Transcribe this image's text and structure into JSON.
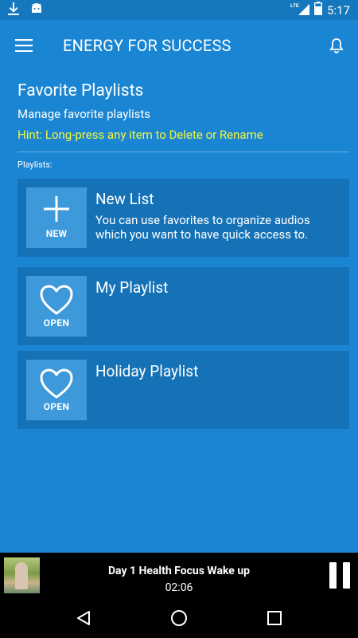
{
  "status_bar": {
    "time": "5:17",
    "network": "LTE",
    "icons": [
      "download-icon",
      "android-icon",
      "signal-icon",
      "battery-icon"
    ]
  },
  "toolbar": {
    "title": "ENERGY FOR SUCCESS",
    "menu_icon": "hamburger-menu-icon",
    "bell_icon": "bell-icon"
  },
  "header": {
    "title": "Favorite Playlists",
    "subtitle": "Manage favorite playlists",
    "hint": "Hint: Long-press any item to Delete or Rename"
  },
  "playlists_label": "Playlists:",
  "cards": [
    {
      "icon": "plus-icon",
      "icon_label": "NEW",
      "title": "New List",
      "description": "You can use favorites to organize audios which you want to have quick access to."
    },
    {
      "icon": "heart-icon",
      "icon_label": "OPEN",
      "title": "My Playlist",
      "description": ""
    },
    {
      "icon": "heart-icon",
      "icon_label": "OPEN",
      "title": "Holiday Playlist",
      "description": ""
    }
  ],
  "now_playing": {
    "title": "Day 1 Health Focus Wake up",
    "time": "02:06",
    "control": "pause-icon"
  },
  "nav_bar": {
    "buttons": [
      "back-icon",
      "home-icon",
      "recents-icon"
    ]
  },
  "colors": {
    "background": "#1a85d3",
    "status_bar": "#1577bd",
    "card": "#1672b6",
    "card_icon_tile": "#3d99d9",
    "hint": "#f4f63a",
    "player_bg": "#000000"
  }
}
